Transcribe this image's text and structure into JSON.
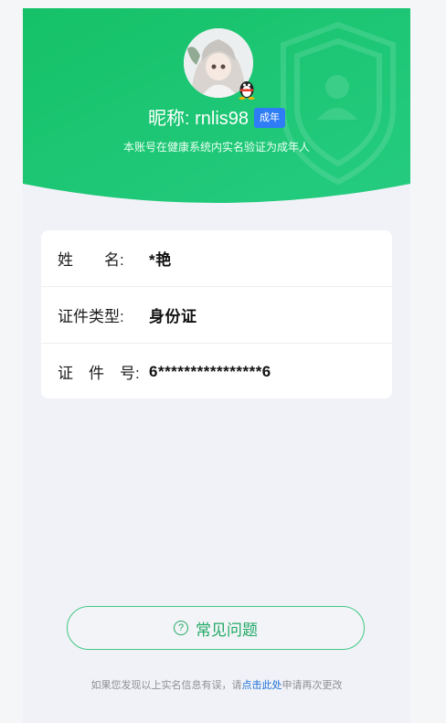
{
  "header": {
    "nickname_label": "昵称: rnlis98",
    "badge": "成年",
    "subtitle": "本账号在健康系统内实名验证为成年人",
    "avatar_icon": "avatar-photo",
    "badge_icon": "qq-penguin-icon",
    "colors": {
      "hero_start": "#1cc46e",
      "hero_end": "#20c879",
      "badge": "#2f7df6"
    }
  },
  "info": {
    "rows": [
      {
        "label": "姓　　名:",
        "value": "*艳"
      },
      {
        "label": "证件类型:",
        "value": "身份证"
      },
      {
        "label": "证　件　号:",
        "value": "6****************6"
      }
    ]
  },
  "faq": {
    "icon": "question-circle-icon",
    "label": "常见问题"
  },
  "footer": {
    "text_before": "如果您发现以上实名信息有误，请",
    "link": "点击此处",
    "text_after": "申请再次更改"
  }
}
